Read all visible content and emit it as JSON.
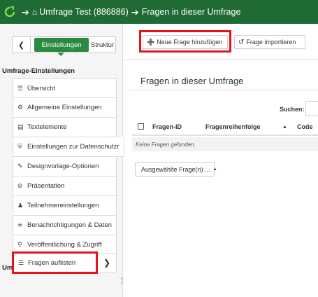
{
  "topbar": {
    "breadcrumb_survey": "Umfrage Test (886886)",
    "breadcrumb_current": "Fragen in dieser Umfrage"
  },
  "sidebar": {
    "tab_settings": "Einstellungen",
    "tab_structure": "Struktur",
    "settings_title": "Umfrage-Einstellungen",
    "settings_items": [
      {
        "label": "Übersicht",
        "icon": "list-icon"
      },
      {
        "label": "Allgemeine Einstellungen",
        "icon": "cogs-icon"
      },
      {
        "label": "Textelemente",
        "icon": "file-text-icon"
      },
      {
        "label": "Einstellungen zur Datenschutzr",
        "icon": "shield-icon"
      },
      {
        "label": "Designvorlage-Optionen",
        "icon": "brush-icon"
      },
      {
        "label": "Präsentation",
        "icon": "eye-slash-icon"
      },
      {
        "label": "Teilnehmereinstellungen",
        "icon": "users-icon"
      },
      {
        "label": "Benachrichtigungen & Daten",
        "icon": "rss-icon"
      },
      {
        "label": "Veröffentlichung & Zugriff",
        "icon": "key-icon"
      }
    ],
    "menu_title": "Umfrage-Menü",
    "list_questions": "Fragen auflisten"
  },
  "toolbar": {
    "add_question": "Neue Frage hinzufügen",
    "import_question": "Frage importieren"
  },
  "main": {
    "title": "Fragen in dieser Umfrage",
    "search_label": "Suchen:",
    "search_value": "",
    "columns": [
      "Fragen-ID",
      "Fragenreihenfolge",
      "Code"
    ],
    "empty_message": "Keine Fragen gefunden.",
    "selected_button": "Ausgewählte Frage(n) ..."
  },
  "colors": {
    "topbar": "#1f6a35",
    "accent": "#2a8a3f",
    "highlight": "#e5141b"
  }
}
